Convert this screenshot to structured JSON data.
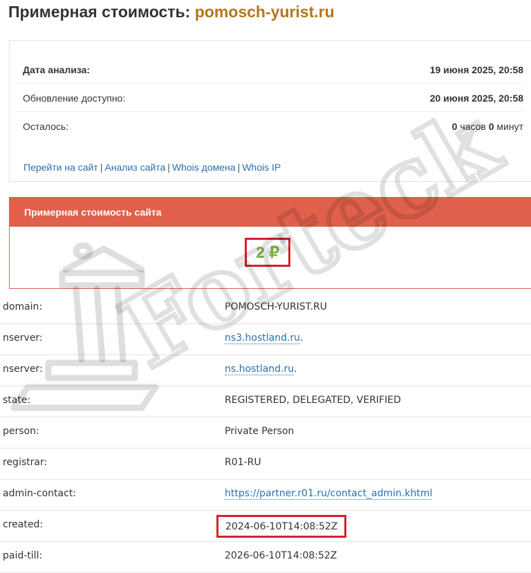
{
  "header": {
    "title_prefix": "Примерная стоимость:",
    "title_domain": "pomosch-yurist.ru"
  },
  "analysis": {
    "rows": [
      {
        "label": "Дата анализа:",
        "value": "19 июня 2025, 20:58"
      },
      {
        "label": "Обновление доступно:",
        "value": "20 июня 2025, 20:58"
      }
    ],
    "remaining": {
      "label": "Осталось:",
      "hours": "0",
      "hours_unit": "часов",
      "minutes": "0",
      "minutes_unit": "минут"
    },
    "links": [
      {
        "label": "Перейти на сайт"
      },
      {
        "label": "Анализ сайта"
      },
      {
        "label": "Whois домена"
      },
      {
        "label": "Whois IP"
      }
    ],
    "link_separator": "|"
  },
  "cost": {
    "header": "Примерная стоимость сайта",
    "value": "2 ₽"
  },
  "whois": [
    {
      "key": "domain:",
      "value": "POMOSCH-YURIST.RU"
    },
    {
      "key": "nserver:",
      "value": "ns3.hostland.ru",
      "suffix": "."
    },
    {
      "key": "nserver:",
      "value": "ns.hostland.ru",
      "suffix": "."
    },
    {
      "key": "state:",
      "value": "REGISTERED, DELEGATED, VERIFIED"
    },
    {
      "key": "person:",
      "value": "Private Person"
    },
    {
      "key": "registrar:",
      "value": "R01-RU"
    },
    {
      "key": "admin-contact:",
      "value": "https://partner.r01.ru/contact_admin.khtml"
    },
    {
      "key": "created:",
      "value": "2024-06-10T14:08:52Z"
    },
    {
      "key": "paid-till:",
      "value": "2026-06-10T14:08:52Z"
    }
  ],
  "watermark": {
    "text": "Forteck",
    "icon": "courthouse-pillar-icon"
  },
  "colors": {
    "title_domain": "#b5761b",
    "cost_header_bg": "#e1604c",
    "cost_value": "#7cb53b",
    "link": "#2b6fb0",
    "highlight_box": "#d4202e"
  }
}
